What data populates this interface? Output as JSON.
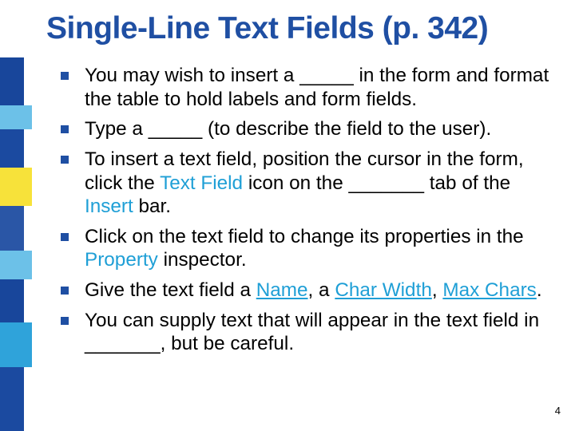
{
  "title": "Single-Line Text Fields (p. 342)",
  "slide_number": "4",
  "bullets": [
    {
      "parts": [
        {
          "t": "You may wish to insert a _____ in the form and format the table to hold labels and form fields."
        }
      ]
    },
    {
      "parts": [
        {
          "t": "Type a _____ (to describe the field to the user)."
        }
      ]
    },
    {
      "parts": [
        {
          "t": "To insert a text field, position the cursor in the form, click the "
        },
        {
          "t": "Text Field",
          "hl": true
        },
        {
          "t": " icon on the _______ tab of the "
        },
        {
          "t": "Insert",
          "hl": true
        },
        {
          "t": " bar."
        }
      ]
    },
    {
      "parts": [
        {
          "t": "Click on the text field to change its properties in the "
        },
        {
          "t": "Property",
          "hl": true
        },
        {
          "t": " inspector."
        }
      ]
    },
    {
      "parts": [
        {
          "t": "Give the text field a "
        },
        {
          "t": "Name",
          "hl": true,
          "u": true
        },
        {
          "t": ", a "
        },
        {
          "t": "Char Width",
          "hl": true,
          "u": true
        },
        {
          "t": ", "
        },
        {
          "t": "Max Chars",
          "hl": true,
          "u": true
        },
        {
          "t": "."
        }
      ]
    },
    {
      "parts": [
        {
          "t": "You can supply text that will appear in the text field in _______, but be careful."
        }
      ]
    }
  ]
}
